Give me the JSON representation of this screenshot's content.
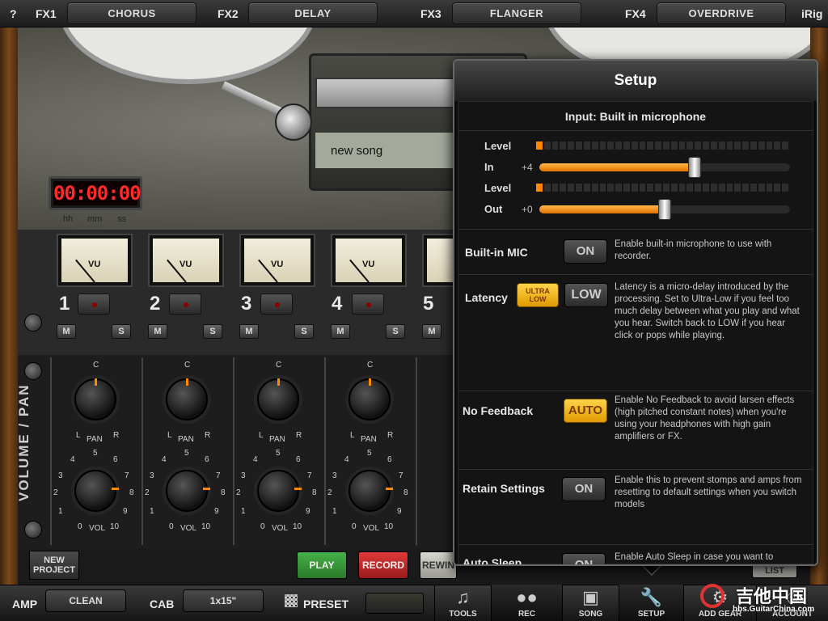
{
  "top_bar": {
    "help_label": "?",
    "fx": [
      {
        "slot": "FX1",
        "effect": "CHORUS"
      },
      {
        "slot": "FX2",
        "effect": "DELAY"
      },
      {
        "slot": "FX3",
        "effect": "FLANGER"
      },
      {
        "slot": "FX4",
        "effect": "OVERDRIVE"
      }
    ],
    "brand_label": "iRig"
  },
  "recorder": {
    "song_name": "new song",
    "counter": "00:00:00",
    "counter_units": [
      "hh",
      "mm",
      "ss"
    ]
  },
  "mixer": {
    "section_label": "VOLUME / PAN",
    "vu_label": "VU",
    "mute_label": "M",
    "solo_label": "S",
    "pan_label": "PAN",
    "pan_center": "C",
    "pan_left": "L",
    "pan_right": "R",
    "vol_label": "VOL",
    "vol_scale": [
      "0",
      "1",
      "2",
      "3",
      "4",
      "5",
      "6",
      "7",
      "8",
      "9",
      "10"
    ],
    "channels": [
      "1",
      "2",
      "3",
      "4",
      "5"
    ]
  },
  "transport": {
    "new_project": "NEW PROJECT",
    "play": "PLAY",
    "record": "RECORD",
    "rewind": "REWIN",
    "list": "LIST",
    "play_color": "#2f8f2f",
    "record_color": "#c02020"
  },
  "bottom_nav": {
    "amp_label": "AMP",
    "amp_value": "CLEAN",
    "cab_label": "CAB",
    "cab_value": "1x15\"",
    "preset_label": "PRESET",
    "tools": [
      {
        "label": "TOOLS",
        "icon": "guitar-icon"
      },
      {
        "label": "REC",
        "icon": "tape-recorder-icon"
      },
      {
        "label": "SONG",
        "icon": "ipod-icon"
      },
      {
        "label": "SETUP",
        "icon": "wrench-icon"
      },
      {
        "label": "ADD GEAR",
        "icon": "gear-add-icon"
      },
      {
        "label": "ACCOUNT",
        "icon": "account-icon"
      }
    ]
  },
  "setup_panel": {
    "title": "Setup",
    "input_label": "Input: Built in microphone",
    "levels": {
      "level_label": "Level",
      "in_label": "In",
      "in_value": "+4",
      "in_slider_fraction": 0.62,
      "out_label": "Out",
      "out_value": "+0",
      "out_slider_fraction": 0.5,
      "level_in_active_segments": 1,
      "level_out_active_segments": 1
    },
    "builtin_mic": {
      "title": "Built-in MIC",
      "button": "ON",
      "description": "Enable built-in microphone to use with recorder."
    },
    "latency": {
      "title": "Latency",
      "ultra_low_line1": "ULTRA",
      "ultra_low_line2": "LOW",
      "low_button": "LOW",
      "description": "Latency is a micro-delay introduced by the processing. Set to Ultra-Low if you feel too much delay between what you play and what you hear. Switch back to LOW if you hear click or pops while playing."
    },
    "no_feedback": {
      "title": "No Feedback",
      "button": "AUTO",
      "description": "Enable No Feedback to avoid larsen effects (high pitched constant notes) when you're using your headphones with high gain amplifiers or FX."
    },
    "retain_settings": {
      "title": "Retain Settings",
      "button": "ON",
      "description": "Enable this to prevent stomps and amps from resetting to default settings when you switch models"
    },
    "auto_sleep": {
      "title": "Auto Sleep",
      "button": "ON",
      "description": "Enable Auto Sleep in case you want to"
    },
    "accent_color": "#ff8800",
    "active_button_color": "#ffc21a"
  },
  "watermark": {
    "text_cn": "吉他中国",
    "url": "bbs.GuitarChina.com"
  }
}
